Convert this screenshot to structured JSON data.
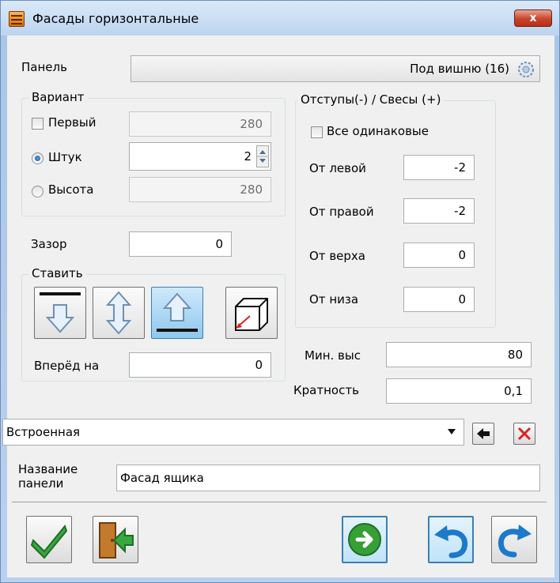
{
  "window": {
    "title": "Фасады горизонтальные",
    "close_label": "x"
  },
  "panel": {
    "label": "Панель",
    "value": "Под вишню (16)"
  },
  "variant": {
    "title": "Вариант",
    "first": {
      "label": "Первый",
      "checked": false,
      "value": "280"
    },
    "count": {
      "label": "Штук",
      "selected": true,
      "value": "2"
    },
    "height": {
      "label": "Высота",
      "selected": false,
      "value": "280"
    }
  },
  "offsets": {
    "title": "Отступы(-) / Свесы (+)",
    "all_same": {
      "label": "Все одинаковые",
      "checked": false
    },
    "left": {
      "label": "От левой",
      "value": "-2"
    },
    "right": {
      "label": "От правой",
      "value": "-2"
    },
    "top": {
      "label": "От верха",
      "value": "0"
    },
    "bottom": {
      "label": "От низа",
      "value": "0"
    }
  },
  "gap": {
    "label": "Зазор",
    "value": "0"
  },
  "place": {
    "title": "Ставить",
    "buttons": [
      "align-top-icon",
      "align-center-icon",
      "align-bottom-icon",
      "offset-forward-icon"
    ],
    "active_index": 2
  },
  "forward": {
    "label": "Вперёд на",
    "value": "0"
  },
  "min_height": {
    "label": "Мин. выс",
    "value": "80"
  },
  "multiplicity": {
    "label": "Кратность",
    "value": "0,1"
  },
  "builtin": {
    "value": "Встроенная"
  },
  "panel_name": {
    "label_line1": "Название",
    "label_line2": "панели",
    "value": "Фасад ящика"
  },
  "colors": {
    "accent": "#3c7fb1",
    "ok_green": "#3aa640",
    "close_red": "#c7452a"
  }
}
